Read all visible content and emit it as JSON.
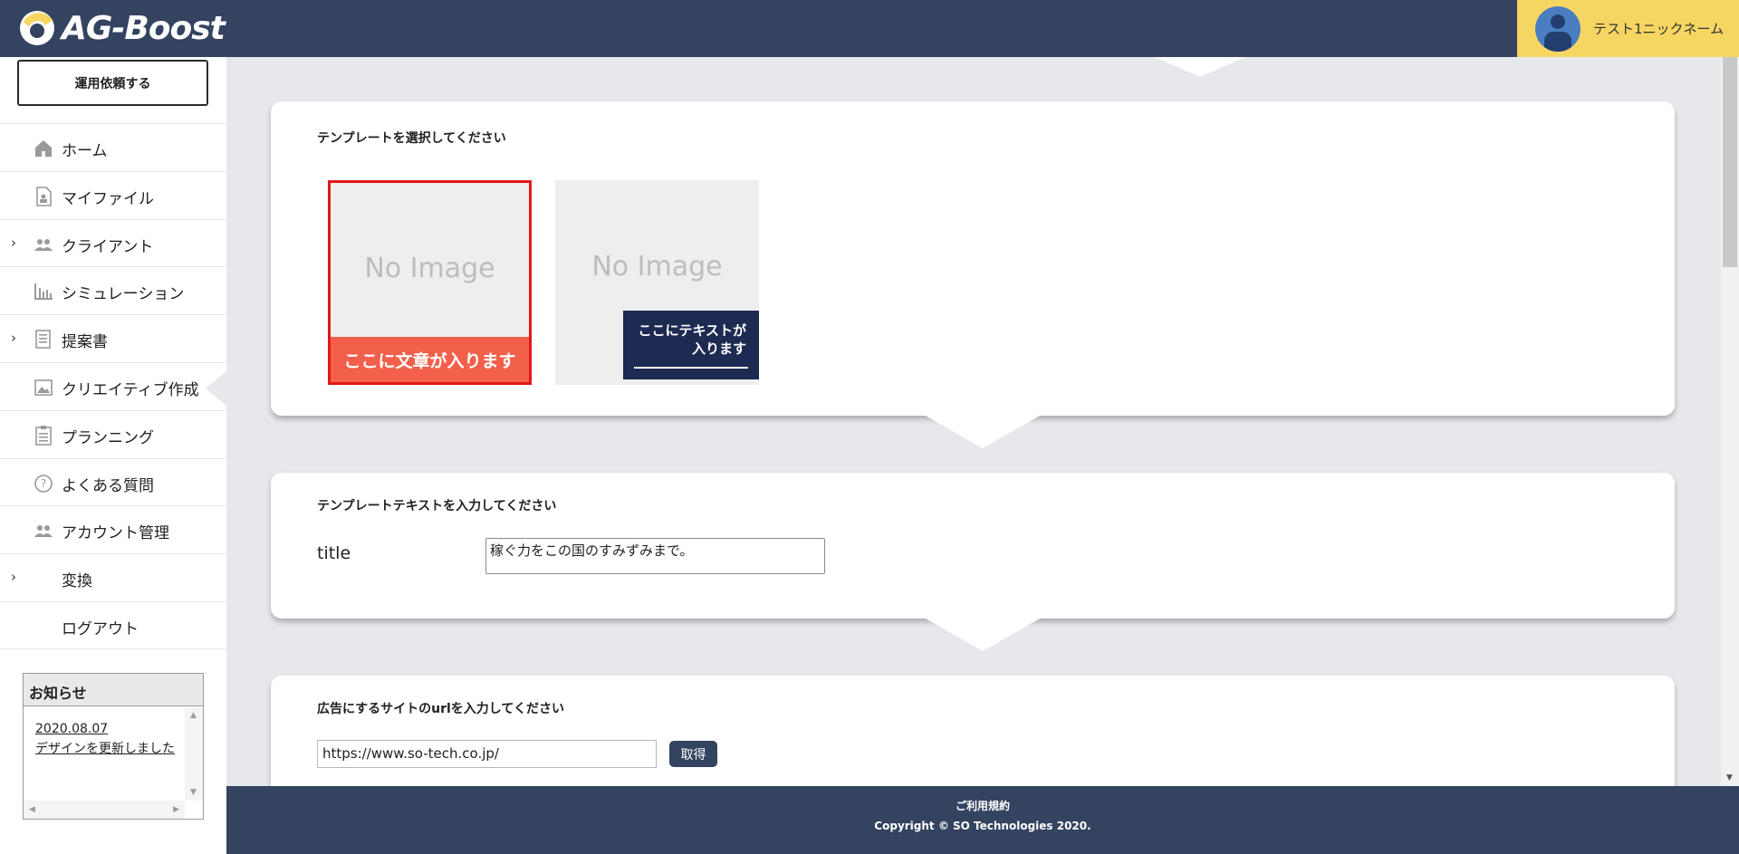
{
  "header": {
    "logo_text": "AG-Boost",
    "user_name": "テスト1ニックネーム"
  },
  "sidebar": {
    "request_button": "運用依頼する",
    "items": [
      {
        "label": "ホーム",
        "icon": "home-icon",
        "has_children": false,
        "active": false
      },
      {
        "label": "マイファイル",
        "icon": "file-icon",
        "has_children": false,
        "active": false
      },
      {
        "label": "クライアント",
        "icon": "users-icon",
        "has_children": true,
        "active": false
      },
      {
        "label": "シミュレーション",
        "icon": "chart-icon",
        "has_children": false,
        "active": false
      },
      {
        "label": "提案書",
        "icon": "document-icon",
        "has_children": true,
        "active": false
      },
      {
        "label": "クリエイティブ作成",
        "icon": "image-icon",
        "has_children": false,
        "active": true
      },
      {
        "label": "プランニング",
        "icon": "clipboard-icon",
        "has_children": false,
        "active": false
      },
      {
        "label": "よくある質問",
        "icon": "question-icon",
        "has_children": false,
        "active": false
      },
      {
        "label": "アカウント管理",
        "icon": "users-icon",
        "has_children": false,
        "active": false
      },
      {
        "label": "変換",
        "icon": "",
        "has_children": true,
        "active": false
      },
      {
        "label": "ログアウト",
        "icon": "",
        "has_children": false,
        "active": false
      }
    ],
    "notice": {
      "title": "お知らせ",
      "date": "2020.08.07",
      "text": "デザインを更新しました"
    }
  },
  "main": {
    "template_section": {
      "title": "テンプレートを選択してください",
      "templates": [
        {
          "placeholder": "No Image",
          "banner": "ここに文章が入ります",
          "selected": true
        },
        {
          "placeholder": "No Image",
          "banner_line1": "ここにテキストが",
          "banner_line2": "入ります",
          "selected": false
        }
      ]
    },
    "text_section": {
      "title": "テンプレートテキストを入力してください",
      "field_label": "title",
      "field_value": "稼ぐ力をこの国のすみずみまで。"
    },
    "url_section": {
      "title": "広告にするサイトのurlを入力してください",
      "url_value": "https://www.so-tech.co.jp/",
      "fetch_button": "取得"
    }
  },
  "footer": {
    "terms": "ご利用規約",
    "copyright": "Copyright © SO Technologies 2020."
  },
  "colors": {
    "navy": "#334360",
    "yellow": "#f6d663",
    "selected_border": "#e31818",
    "banner_orange": "#f2604b",
    "banner_navy": "#1d2a52"
  }
}
